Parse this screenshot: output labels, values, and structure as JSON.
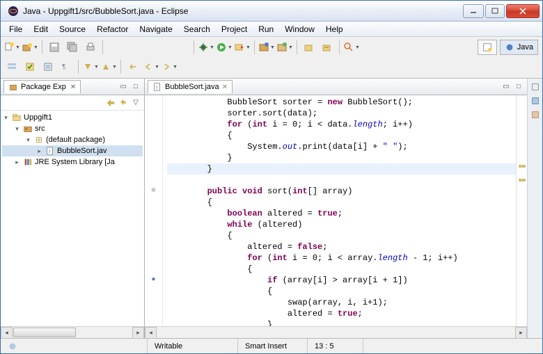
{
  "window": {
    "title": "Java - Uppgift1/src/BubbleSort.java - Eclipse"
  },
  "menu": [
    "File",
    "Edit",
    "Source",
    "Refactor",
    "Navigate",
    "Search",
    "Project",
    "Run",
    "Window",
    "Help"
  ],
  "perspective": {
    "label": "Java"
  },
  "packageExplorer": {
    "title": "Package Exp",
    "items": {
      "project": "Uppgift1",
      "src": "src",
      "pkg": "(default package)",
      "file": "BubbleSort.jav",
      "jre": "JRE System Library [Ja"
    }
  },
  "editor": {
    "tab": "BubbleSort.java",
    "lines": [
      {
        "indent": 3,
        "tokens": [
          [
            "",
            "BubbleSort sorter = "
          ],
          [
            "kw",
            "new"
          ],
          [
            "",
            " BubbleSort();"
          ]
        ]
      },
      {
        "indent": 3,
        "tokens": [
          [
            "",
            "sorter.sort(data);"
          ]
        ]
      },
      {
        "indent": 3,
        "tokens": [
          [
            "kw",
            "for"
          ],
          [
            "",
            " ("
          ],
          [
            "kw",
            "int"
          ],
          [
            "",
            " i = 0; i < data."
          ],
          [
            "field",
            "length"
          ],
          [
            "",
            "; i++)"
          ]
        ]
      },
      {
        "indent": 3,
        "tokens": [
          [
            "",
            "{"
          ]
        ]
      },
      {
        "indent": 4,
        "tokens": [
          [
            "",
            "System."
          ],
          [
            "field",
            "out"
          ],
          [
            "",
            ".print(data[i] + "
          ],
          [
            "str",
            "\" \""
          ],
          [
            "",
            ");"
          ]
        ]
      },
      {
        "indent": 3,
        "tokens": [
          [
            "",
            "}"
          ]
        ]
      },
      {
        "indent": 2,
        "tokens": [
          [
            "",
            "}"
          ]
        ],
        "hl": true
      },
      {
        "indent": 0,
        "tokens": [
          [
            "",
            ""
          ]
        ]
      },
      {
        "indent": 2,
        "tokens": [
          [
            "kw",
            "public"
          ],
          [
            "",
            " "
          ],
          [
            "kw",
            "void"
          ],
          [
            "",
            " sort("
          ],
          [
            "kw",
            "int"
          ],
          [
            "",
            "[] array)"
          ]
        ],
        "gutter": "⊖"
      },
      {
        "indent": 2,
        "tokens": [
          [
            "",
            "{"
          ]
        ]
      },
      {
        "indent": 3,
        "tokens": [
          [
            "kw",
            "boolean"
          ],
          [
            "",
            " altered = "
          ],
          [
            "kw",
            "true"
          ],
          [
            "",
            ";"
          ]
        ]
      },
      {
        "indent": 3,
        "tokens": [
          [
            "kw",
            "while"
          ],
          [
            "",
            " (altered)"
          ]
        ]
      },
      {
        "indent": 3,
        "tokens": [
          [
            "",
            "{"
          ]
        ]
      },
      {
        "indent": 4,
        "tokens": [
          [
            "",
            "altered = "
          ],
          [
            "kw",
            "false"
          ],
          [
            "",
            ";"
          ]
        ]
      },
      {
        "indent": 4,
        "tokens": [
          [
            "kw",
            "for"
          ],
          [
            "",
            " ("
          ],
          [
            "kw",
            "int"
          ],
          [
            "",
            " i = 0; i < array."
          ],
          [
            "field",
            "length"
          ],
          [
            "",
            " - 1; i++)"
          ]
        ]
      },
      {
        "indent": 4,
        "tokens": [
          [
            "",
            "{"
          ]
        ]
      },
      {
        "indent": 5,
        "tokens": [
          [
            "kw",
            "if"
          ],
          [
            "",
            " (array[i] > array[i + 1])"
          ]
        ],
        "gutter": "●"
      },
      {
        "indent": 5,
        "tokens": [
          [
            "",
            "{"
          ]
        ]
      },
      {
        "indent": 6,
        "tokens": [
          [
            "",
            "swap(array, i, i+1);"
          ]
        ]
      },
      {
        "indent": 6,
        "tokens": [
          [
            "",
            "altered = "
          ],
          [
            "kw",
            "true"
          ],
          [
            "",
            ";"
          ]
        ]
      },
      {
        "indent": 5,
        "tokens": [
          [
            "",
            "}"
          ]
        ]
      }
    ]
  },
  "status": {
    "writable": "Writable",
    "insert": "Smart Insert",
    "pos": "13 : 5"
  }
}
